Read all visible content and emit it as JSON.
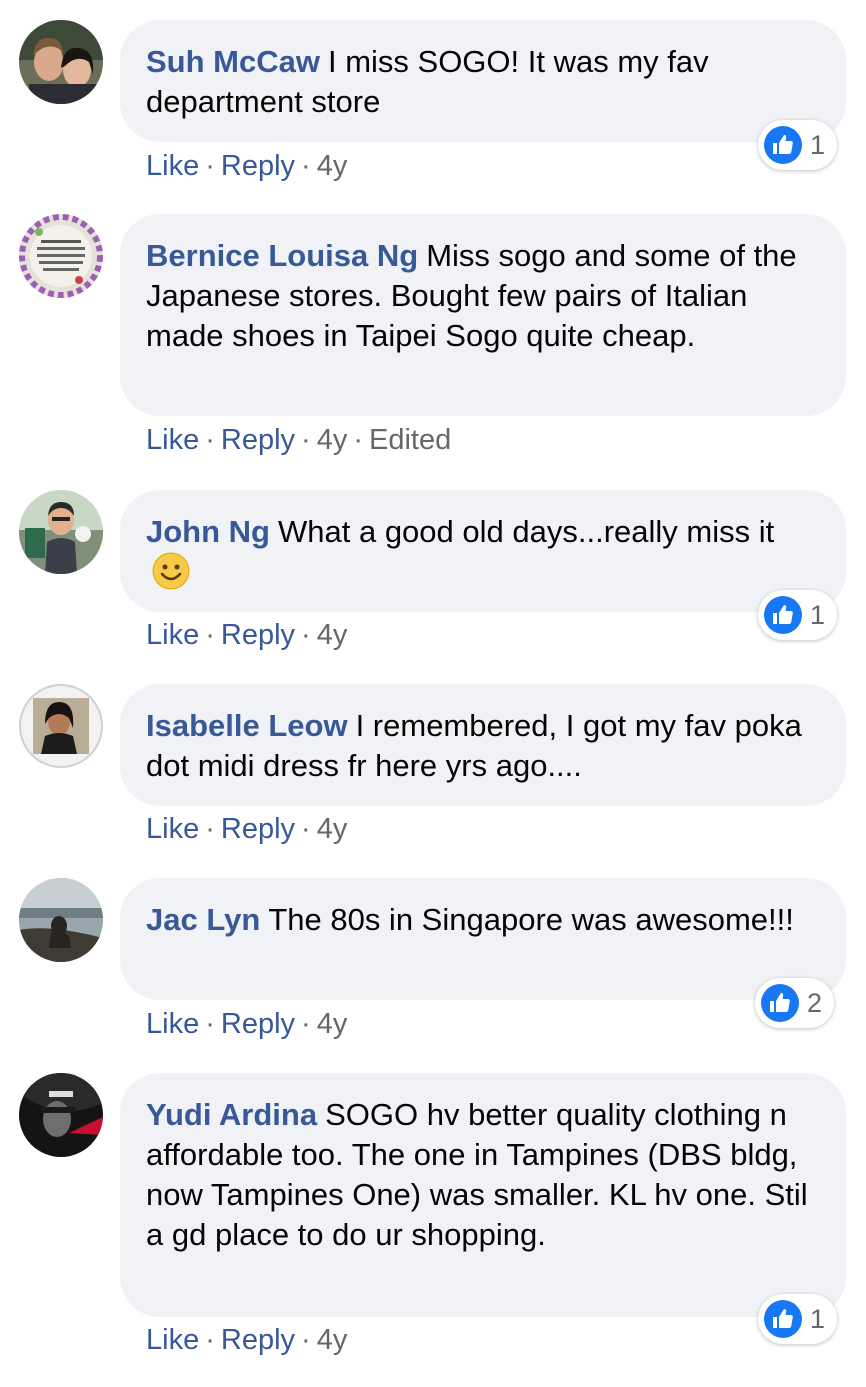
{
  "colors": {
    "accent": "#385898",
    "like_blue": "#1877f2",
    "bubble": "#f0f2f5",
    "meta": "#65676b"
  },
  "actions": {
    "like": "Like",
    "reply": "Reply",
    "dot": "·"
  },
  "comments": [
    {
      "author": "Suh McCaw",
      "text": "I miss SOGO! It was my fav department store",
      "age": "4y",
      "edited": "",
      "reactions": "1",
      "avatar": "couple-photo"
    },
    {
      "author": "Bernice Louisa Ng",
      "text": "Miss sogo and some of the Japanese stores. Bought few pairs of Italian made shoes in Taipei Sogo quite cheap.",
      "age": "4y",
      "edited": "Edited",
      "reactions": "",
      "avatar": "floral-frame"
    },
    {
      "author": "John Ng",
      "text": "What a good old days...really miss it",
      "age": "4y",
      "edited": "",
      "reactions": "1",
      "avatar": "cartoon-man",
      "emoji": "smiling-face-icon"
    },
    {
      "author": "Isabelle Leow",
      "text": "I remembered, I got my fav poka dot midi dress fr here yrs ago....",
      "age": "4y",
      "edited": "",
      "reactions": "",
      "avatar": "woman-photo"
    },
    {
      "author": "Jac Lyn",
      "text": "The 80s in Singapore was awesome!!!",
      "age": "4y",
      "edited": "",
      "reactions": "2",
      "avatar": "beach-photo"
    },
    {
      "author": "Yudi Ardina",
      "text": "SOGO hv better quality clothing n affordable too. The one in Tampines (DBS bldg, now Tampines One) was smaller. KL hv one. Stil a gd place to do ur shopping.",
      "age": "4y",
      "edited": "",
      "reactions": "1",
      "avatar": "dark-poster"
    }
  ]
}
